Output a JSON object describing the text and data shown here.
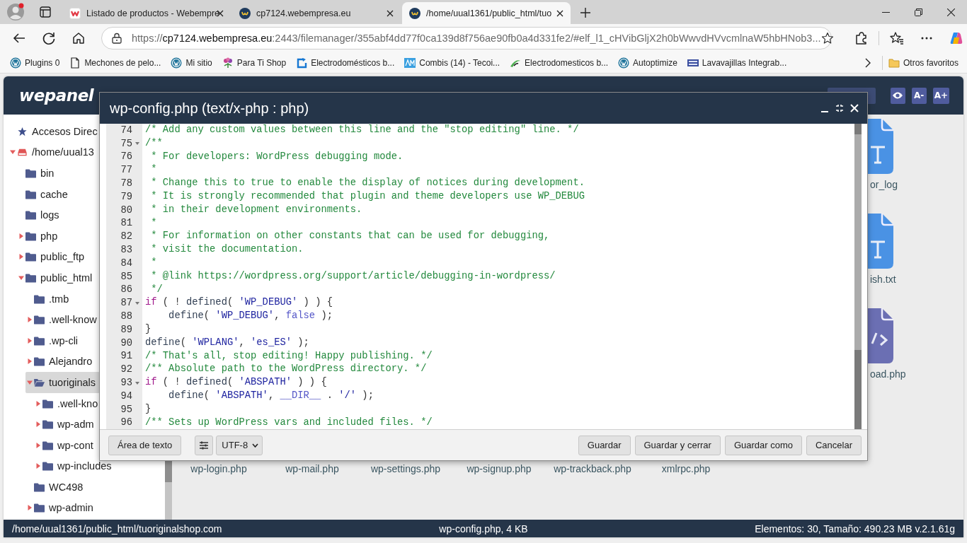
{
  "browser": {
    "tabs": [
      {
        "title": "Listado de productos - Webempre",
        "kind": "webempresa",
        "selected": false
      },
      {
        "title": "cp7124.webempresa.eu",
        "kind": "wepanel",
        "selected": false
      },
      {
        "title": "/home/uual1361/public_html/tuo",
        "kind": "wepanel",
        "selected": true
      }
    ],
    "address": {
      "scheme": "https://",
      "host": "cp7124.webempresa.eu",
      "rest": ":2443/filemanager/355abf4dd77f0ca139d8f756ae90fb0a4d331fe2/#elf_l1_cHVibGljX2h0bWwvdHVvcmlnaW5hbHNob3..."
    },
    "bookmarks": [
      {
        "label": "Plugins 0",
        "kind": "wordpress"
      },
      {
        "label": "Mechones de pelo...",
        "kind": "page"
      },
      {
        "label": "Mi sitio",
        "kind": "wordpress"
      },
      {
        "label": "Para Ti Shop",
        "kind": "flower"
      },
      {
        "label": "Electrodomésticos b...",
        "kind": "arrow"
      },
      {
        "label": "Combis (14) - Tecoi...",
        "kind": "monogram"
      },
      {
        "label": "Electrodomesticos b...",
        "kind": "swoosh"
      },
      {
        "label": "Autoptimize",
        "kind": "wordpress"
      },
      {
        "label": "Lavavajillas Integrab...",
        "kind": "banner"
      }
    ],
    "other_bookmarks": "Otros favoritos"
  },
  "file_manager": {
    "logo": "wepanel",
    "font_buttons": [
      "A-",
      "A+"
    ],
    "tree": [
      {
        "label": "Accesos Direc",
        "kind": "star",
        "selected": false
      },
      {
        "label": "/home/uual13",
        "kind": "drive",
        "expanded": true,
        "selected": false,
        "children": [
          {
            "label": "bin",
            "kind": "folder",
            "selected": false
          },
          {
            "label": "cache",
            "kind": "folder",
            "selected": false
          },
          {
            "label": "logs",
            "kind": "folder",
            "selected": false
          },
          {
            "label": "php",
            "kind": "folder",
            "expanded": false,
            "selected": false
          },
          {
            "label": "public_ftp",
            "kind": "folder",
            "expanded": false,
            "selected": false
          },
          {
            "label": "public_html",
            "kind": "folder",
            "expanded": true,
            "selected": false,
            "children": [
              {
                "label": ".tmb",
                "kind": "folder",
                "selected": false
              },
              {
                "label": ".well-know",
                "kind": "folder",
                "expanded": false,
                "selected": false
              },
              {
                "label": ".wp-cli",
                "kind": "folder",
                "expanded": false,
                "selected": false
              },
              {
                "label": "Alejandro",
                "kind": "folder",
                "expanded": false,
                "selected": false
              },
              {
                "label": "tuoriginals",
                "kind": "folder-open",
                "expanded": true,
                "selected": true,
                "children": [
                  {
                    "label": ".well-kno",
                    "kind": "folder",
                    "expanded": false,
                    "selected": false
                  },
                  {
                    "label": "wp-adm",
                    "kind": "folder",
                    "expanded": false,
                    "selected": false
                  },
                  {
                    "label": "wp-cont",
                    "kind": "folder",
                    "expanded": false,
                    "selected": false
                  },
                  {
                    "label": "wp-includes",
                    "kind": "folder",
                    "expanded": false,
                    "selected": false
                  }
                ]
              },
              {
                "label": "WC498",
                "kind": "folder",
                "selected": false
              },
              {
                "label": "wp-admin",
                "kind": "folder",
                "expanded": false,
                "selected": false
              }
            ]
          }
        ]
      }
    ],
    "file_grid": {
      "right_column": [
        {
          "name": "or_log",
          "kind": "text"
        },
        {
          "name": "ish.txt",
          "kind": "text"
        },
        {
          "name": "oad.php",
          "kind": "code"
        }
      ],
      "bottom_row": [
        "wp-login.php",
        "wp-mail.php",
        "wp-settings.php",
        "wp-signup.php",
        "wp-trackback.php",
        "xmlrpc.php"
      ]
    },
    "status_bar": {
      "path": "/home/uual1361/public_html/tuoriginalshop.com",
      "file": "wp-config.php, 4 KB",
      "summary": "Elementos: 30, Tamaño: 490.23 MB v.2.1.61g"
    }
  },
  "editor": {
    "title": "wp-config.php (text/x-php : php)",
    "lines": [
      {
        "n": "74",
        "fold": false,
        "tokens": [
          {
            "kind": "comment",
            "text": "/* Add any custom values between this line and the \"stop editing\" line. */"
          }
        ]
      },
      {
        "n": "75",
        "fold": true,
        "tokens": [
          {
            "kind": "comment",
            "text": "/**"
          }
        ]
      },
      {
        "n": "76",
        "fold": false,
        "tokens": [
          {
            "kind": "comment",
            "text": " * For developers: WordPress debugging mode."
          }
        ]
      },
      {
        "n": "77",
        "fold": false,
        "tokens": [
          {
            "kind": "comment",
            "text": " *"
          }
        ]
      },
      {
        "n": "78",
        "fold": false,
        "tokens": [
          {
            "kind": "comment",
            "text": " * Change this to true to enable the display of notices during development."
          }
        ]
      },
      {
        "n": "79",
        "fold": false,
        "tokens": [
          {
            "kind": "comment",
            "text": " * It is strongly recommended that plugin and theme developers use WP_DEBUG"
          }
        ]
      },
      {
        "n": "80",
        "fold": false,
        "tokens": [
          {
            "kind": "comment",
            "text": " * in their development environments."
          }
        ]
      },
      {
        "n": "81",
        "fold": false,
        "tokens": [
          {
            "kind": "comment",
            "text": " *"
          }
        ]
      },
      {
        "n": "82",
        "fold": false,
        "tokens": [
          {
            "kind": "comment",
            "text": " * For information on other constants that can be used for debugging,"
          }
        ]
      },
      {
        "n": "83",
        "fold": false,
        "tokens": [
          {
            "kind": "comment",
            "text": " * visit the documentation."
          }
        ]
      },
      {
        "n": "84",
        "fold": false,
        "tokens": [
          {
            "kind": "comment",
            "text": " *"
          }
        ]
      },
      {
        "n": "85",
        "fold": false,
        "tokens": [
          {
            "kind": "comment",
            "text": " * @link https://wordpress.org/support/article/debugging-in-wordpress/"
          }
        ]
      },
      {
        "n": "86",
        "fold": false,
        "tokens": [
          {
            "kind": "comment",
            "text": " */"
          }
        ]
      },
      {
        "n": "87",
        "fold": true,
        "tokens": [
          {
            "kind": "keyword",
            "text": "if"
          },
          {
            "kind": "plain",
            "text": " ( ! "
          },
          {
            "kind": "builtin",
            "text": "defined"
          },
          {
            "kind": "plain",
            "text": "( "
          },
          {
            "kind": "string",
            "text": "'WP_DEBUG'"
          },
          {
            "kind": "plain",
            "text": " ) ) {"
          }
        ]
      },
      {
        "n": "88",
        "fold": false,
        "tokens": [
          {
            "kind": "builtin",
            "text": "    define"
          },
          {
            "kind": "plain",
            "text": "( "
          },
          {
            "kind": "string",
            "text": "'WP_DEBUG'"
          },
          {
            "kind": "plain",
            "text": ", "
          },
          {
            "kind": "atom",
            "text": "false"
          },
          {
            "kind": "plain",
            "text": " );"
          }
        ]
      },
      {
        "n": "89",
        "fold": false,
        "tokens": [
          {
            "kind": "plain",
            "text": "}"
          }
        ]
      },
      {
        "n": "90",
        "fold": false,
        "tokens": [
          {
            "kind": "builtin",
            "text": "define"
          },
          {
            "kind": "plain",
            "text": "( "
          },
          {
            "kind": "string",
            "text": "'WPLANG'"
          },
          {
            "kind": "plain",
            "text": ", "
          },
          {
            "kind": "string",
            "text": "'es_ES'"
          },
          {
            "kind": "plain",
            "text": " );"
          }
        ]
      },
      {
        "n": "91",
        "fold": false,
        "tokens": [
          {
            "kind": "comment",
            "text": "/* That's all, stop editing! Happy publishing. */"
          }
        ]
      },
      {
        "n": "92",
        "fold": false,
        "tokens": [
          {
            "kind": "comment",
            "text": "/** Absolute path to the WordPress directory. */"
          }
        ]
      },
      {
        "n": "93",
        "fold": true,
        "tokens": [
          {
            "kind": "keyword",
            "text": "if"
          },
          {
            "kind": "plain",
            "text": " ( ! "
          },
          {
            "kind": "builtin",
            "text": "defined"
          },
          {
            "kind": "plain",
            "text": "( "
          },
          {
            "kind": "string",
            "text": "'ABSPATH'"
          },
          {
            "kind": "plain",
            "text": " ) ) {"
          }
        ]
      },
      {
        "n": "94",
        "fold": false,
        "tokens": [
          {
            "kind": "builtin",
            "text": "    define"
          },
          {
            "kind": "plain",
            "text": "( "
          },
          {
            "kind": "string",
            "text": "'ABSPATH'"
          },
          {
            "kind": "plain",
            "text": ", "
          },
          {
            "kind": "atom",
            "text": "__DIR__"
          },
          {
            "kind": "plain",
            "text": " . "
          },
          {
            "kind": "string",
            "text": "'/'"
          },
          {
            "kind": "plain",
            "text": " );"
          }
        ]
      },
      {
        "n": "95",
        "fold": false,
        "tokens": [
          {
            "kind": "plain",
            "text": "}"
          }
        ]
      },
      {
        "n": "96",
        "fold": false,
        "tokens": [
          {
            "kind": "comment",
            "text": "/** Sets up WordPress vars and included files. */"
          }
        ]
      }
    ],
    "footer": {
      "mode_button": "Área de texto",
      "encoding": "UTF-8",
      "buttons": [
        "Guardar",
        "Guardar y cerrar",
        "Guardar como",
        "Cancelar"
      ]
    }
  }
}
